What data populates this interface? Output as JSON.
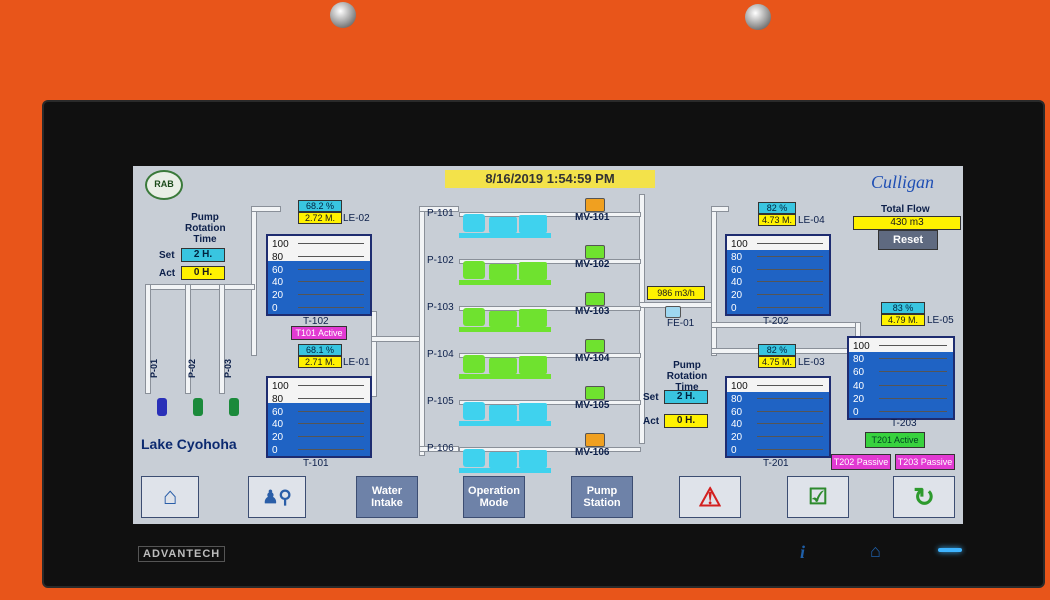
{
  "datetime": "8/16/2019 1:54:59 PM",
  "logo_left": "RAB",
  "logo_right": "Culligan",
  "pump_rotation_left": {
    "title1": "Pump",
    "title2": "Rotation",
    "title3": "Time",
    "set_label": "Set",
    "set_value": "2 H.",
    "act_label": "Act",
    "act_value": "0 H."
  },
  "pump_rotation_right": {
    "title1": "Pump",
    "title2": "Rotation",
    "title3": "Time",
    "set_label": "Set",
    "set_value": "2 H.",
    "act_label": "Act",
    "act_value": "0 H."
  },
  "total_flow": {
    "label": "Total Flow",
    "value": "430 m3",
    "reset_label": "Reset"
  },
  "scale": [
    "100",
    "80",
    "60",
    "40",
    "20",
    "0"
  ],
  "tanks": {
    "t102": {
      "name": "T-102",
      "percent": "68.2 %",
      "level": "2.72 M.",
      "sensor": "LE-02",
      "fill_pct": 68.2
    },
    "t101": {
      "name": "T-101",
      "percent": "68.1 %",
      "level": "2.71 M.",
      "sensor": "LE-01",
      "fill_pct": 68.1,
      "status": "T101 Active"
    },
    "t202": {
      "name": "T-202",
      "percent": "82 %",
      "level": "4.73 M.",
      "sensor": "LE-04",
      "fill_pct": 82
    },
    "t201": {
      "name": "T-201",
      "percent": "82 %",
      "level": "4.75 M.",
      "sensor": "LE-03",
      "fill_pct": 82
    },
    "t203": {
      "name": "T-203",
      "percent": "83 %",
      "level": "4.79 M.",
      "sensor": "LE-05",
      "fill_pct": 83,
      "status": "T201 Active"
    }
  },
  "status_bottom_1": "T202 Passive",
  "status_bottom_2": "T203 Passive",
  "lake": "Lake Cyohoha",
  "intake_pumps": [
    "P-01",
    "P-02",
    "P-03"
  ],
  "pumps": [
    {
      "label": "P-101",
      "valve": "MV-101",
      "color": "#3fd2ee",
      "valve_color": "#f0a020"
    },
    {
      "label": "P-102",
      "valve": "MV-102",
      "color": "#6fe22f",
      "valve_color": "#6fe22f"
    },
    {
      "label": "P-103",
      "valve": "MV-103",
      "color": "#6fe22f",
      "valve_color": "#6fe22f"
    },
    {
      "label": "P-104",
      "valve": "MV-104",
      "color": "#6fe22f",
      "valve_color": "#6fe22f"
    },
    {
      "label": "P-105",
      "valve": "MV-105",
      "color": "#3fd2ee",
      "valve_color": "#6fe22f"
    },
    {
      "label": "P-106",
      "valve": "MV-106",
      "color": "#3fd2ee",
      "valve_color": "#f0a020"
    }
  ],
  "flow_meter": {
    "value": "986 m3/h",
    "label": "FE-01"
  },
  "nav": {
    "water_intake": "Water Intake",
    "operation_mode": "Operation Mode",
    "pump_station": "Pump Station"
  },
  "bezel": {
    "brand": "ADVANTECH"
  }
}
